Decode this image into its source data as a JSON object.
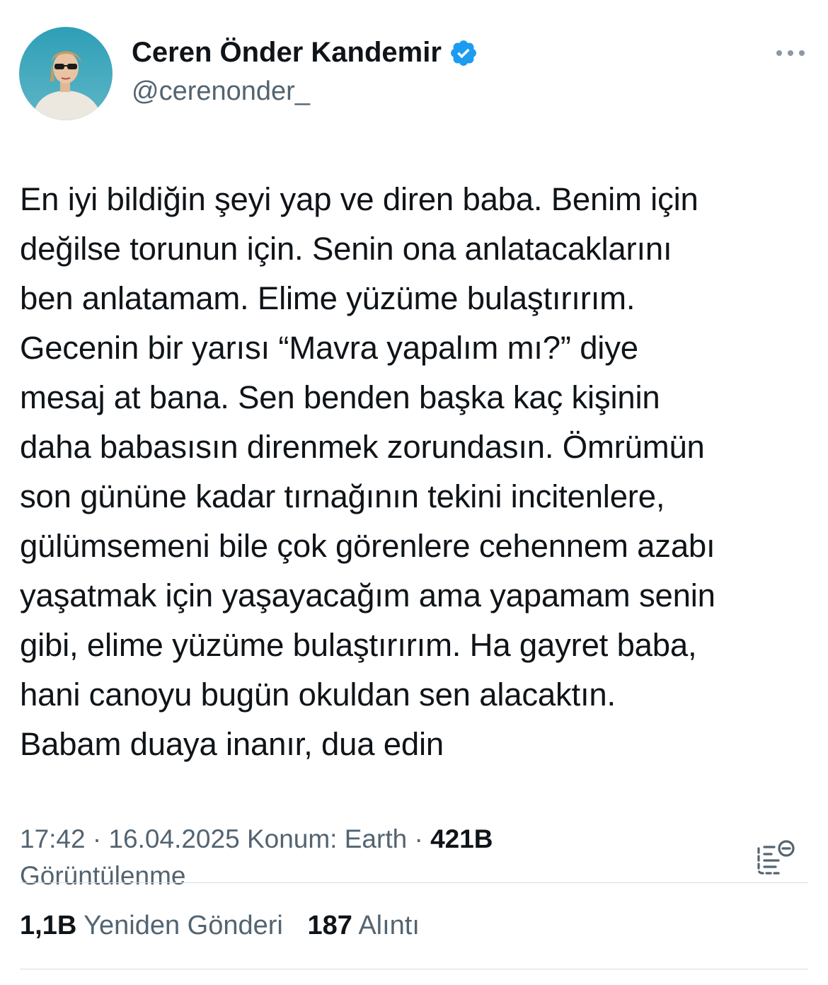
{
  "author": {
    "display_name": "Ceren Önder Kandemir",
    "handle": "@cerenonder_",
    "verified_color": "#1d9bf0",
    "avatar_icon": "avatar-photo"
  },
  "tweet": {
    "text": "En iyi bildiğin şeyi yap ve diren baba. Benim için\ndeğilse torunun için. Senin ona anlatacaklarını\nben anlatamam. Elime yüzüme bulaştırırım.\nGecenin bir yarısı “Mavra yapalım mı?” diye\nmesaj at bana. Sen benden başka kaç kişinin\ndaha babasısın direnmek zorundasın. Ömrümün\nson gününe kadar tırnağının tekini incitenlere,\ngülümsemeni bile çok görenlere cehennem azabı\nyaşatmak için yaşayacağım ama yapamam senin\ngibi, elime yüzüme bulaştırırım. Ha gayret baba,\nhani canoyu bugün okuldan sen alacaktın.\nBabam duaya inanır, dua edin"
  },
  "meta": {
    "time": "17:42",
    "date": "16.04.2025",
    "location": "Konum: Earth",
    "separator": "·",
    "views_count": "421B",
    "views_label": "Görüntülenme"
  },
  "stats": {
    "reposts_count": "1,1B",
    "reposts_label": "Yeniden Gönderi",
    "quotes_count": "187",
    "quotes_label": "Alıntı"
  },
  "colors": {
    "text": "#0f1419",
    "secondary": "#536471",
    "accent": "#1d9bf0"
  }
}
